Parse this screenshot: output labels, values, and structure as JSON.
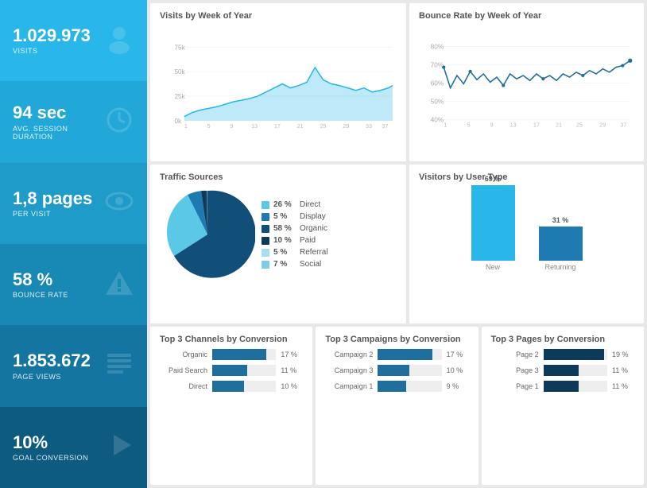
{
  "sidebar": {
    "items": [
      {
        "value": "1.029.973",
        "label": "VISITS",
        "icon": "person"
      },
      {
        "value": "94 sec",
        "label": "AVG. SESSION\nDURATION",
        "icon": "clock"
      },
      {
        "value": "1,8 pages",
        "label": "PER VISIT",
        "icon": "eye"
      },
      {
        "value": "58 %",
        "label": "BOUNCE RATE",
        "icon": "warning"
      },
      {
        "value": "1.853.672",
        "label": "PAGE VIEWS",
        "icon": "list"
      },
      {
        "value": "10%",
        "label": "GOAL CONVERSION",
        "icon": "flag"
      }
    ]
  },
  "visits_chart": {
    "title": "Visits by Week of Year",
    "y_labels": [
      "75k",
      "50k",
      "25k",
      "0k"
    ]
  },
  "bounce_chart": {
    "title": "Bounce Rate by Week of Year",
    "y_labels": [
      "80%",
      "70%",
      "60%",
      "50%",
      "40%"
    ]
  },
  "traffic_sources": {
    "title": "Traffic Sources",
    "segments": [
      {
        "label": "Direct",
        "pct": "26 %",
        "color": "#5bc8e8"
      },
      {
        "label": "Display",
        "pct": "5 %",
        "color": "#1e7ab0"
      },
      {
        "label": "Organic",
        "pct": "58 %",
        "color": "#124f78"
      },
      {
        "label": "Paid",
        "pct": "10 %",
        "color": "#0d3a58"
      },
      {
        "label": "Referral",
        "pct": "5 %",
        "color": "#a8dff0"
      },
      {
        "label": "Social",
        "pct": "7 %",
        "color": "#7ecde8"
      }
    ]
  },
  "visitors_by_type": {
    "title": "Visitors by User Type",
    "bars": [
      {
        "label": "New",
        "pct": "69 %",
        "height": 95
      },
      {
        "label": "Returning",
        "pct": "31 %",
        "height": 43
      }
    ]
  },
  "channels": {
    "title": "Top 3 Channels by Conversion",
    "bars": [
      {
        "label": "Organic",
        "pct": "17 %",
        "value": 17
      },
      {
        "label": "Paid Search",
        "pct": "11 %",
        "value": 11
      },
      {
        "label": "Direct",
        "pct": "10 %",
        "value": 10
      }
    ]
  },
  "campaigns": {
    "title": "Top 3 Campaigns by Conversion",
    "bars": [
      {
        "label": "Campaign 2",
        "pct": "17 %",
        "value": 17
      },
      {
        "label": "Campaign 3",
        "pct": "10 %",
        "value": 10
      },
      {
        "label": "Campaign 1",
        "pct": "9 %",
        "value": 9
      }
    ]
  },
  "pages": {
    "title": "Top 3 Pages by Conversion",
    "bars": [
      {
        "label": "Page 2",
        "pct": "19 %",
        "value": 19
      },
      {
        "label": "Page 3",
        "pct": "11 %",
        "value": 11
      },
      {
        "label": "Page 1",
        "pct": "11 %",
        "value": 11
      }
    ]
  }
}
